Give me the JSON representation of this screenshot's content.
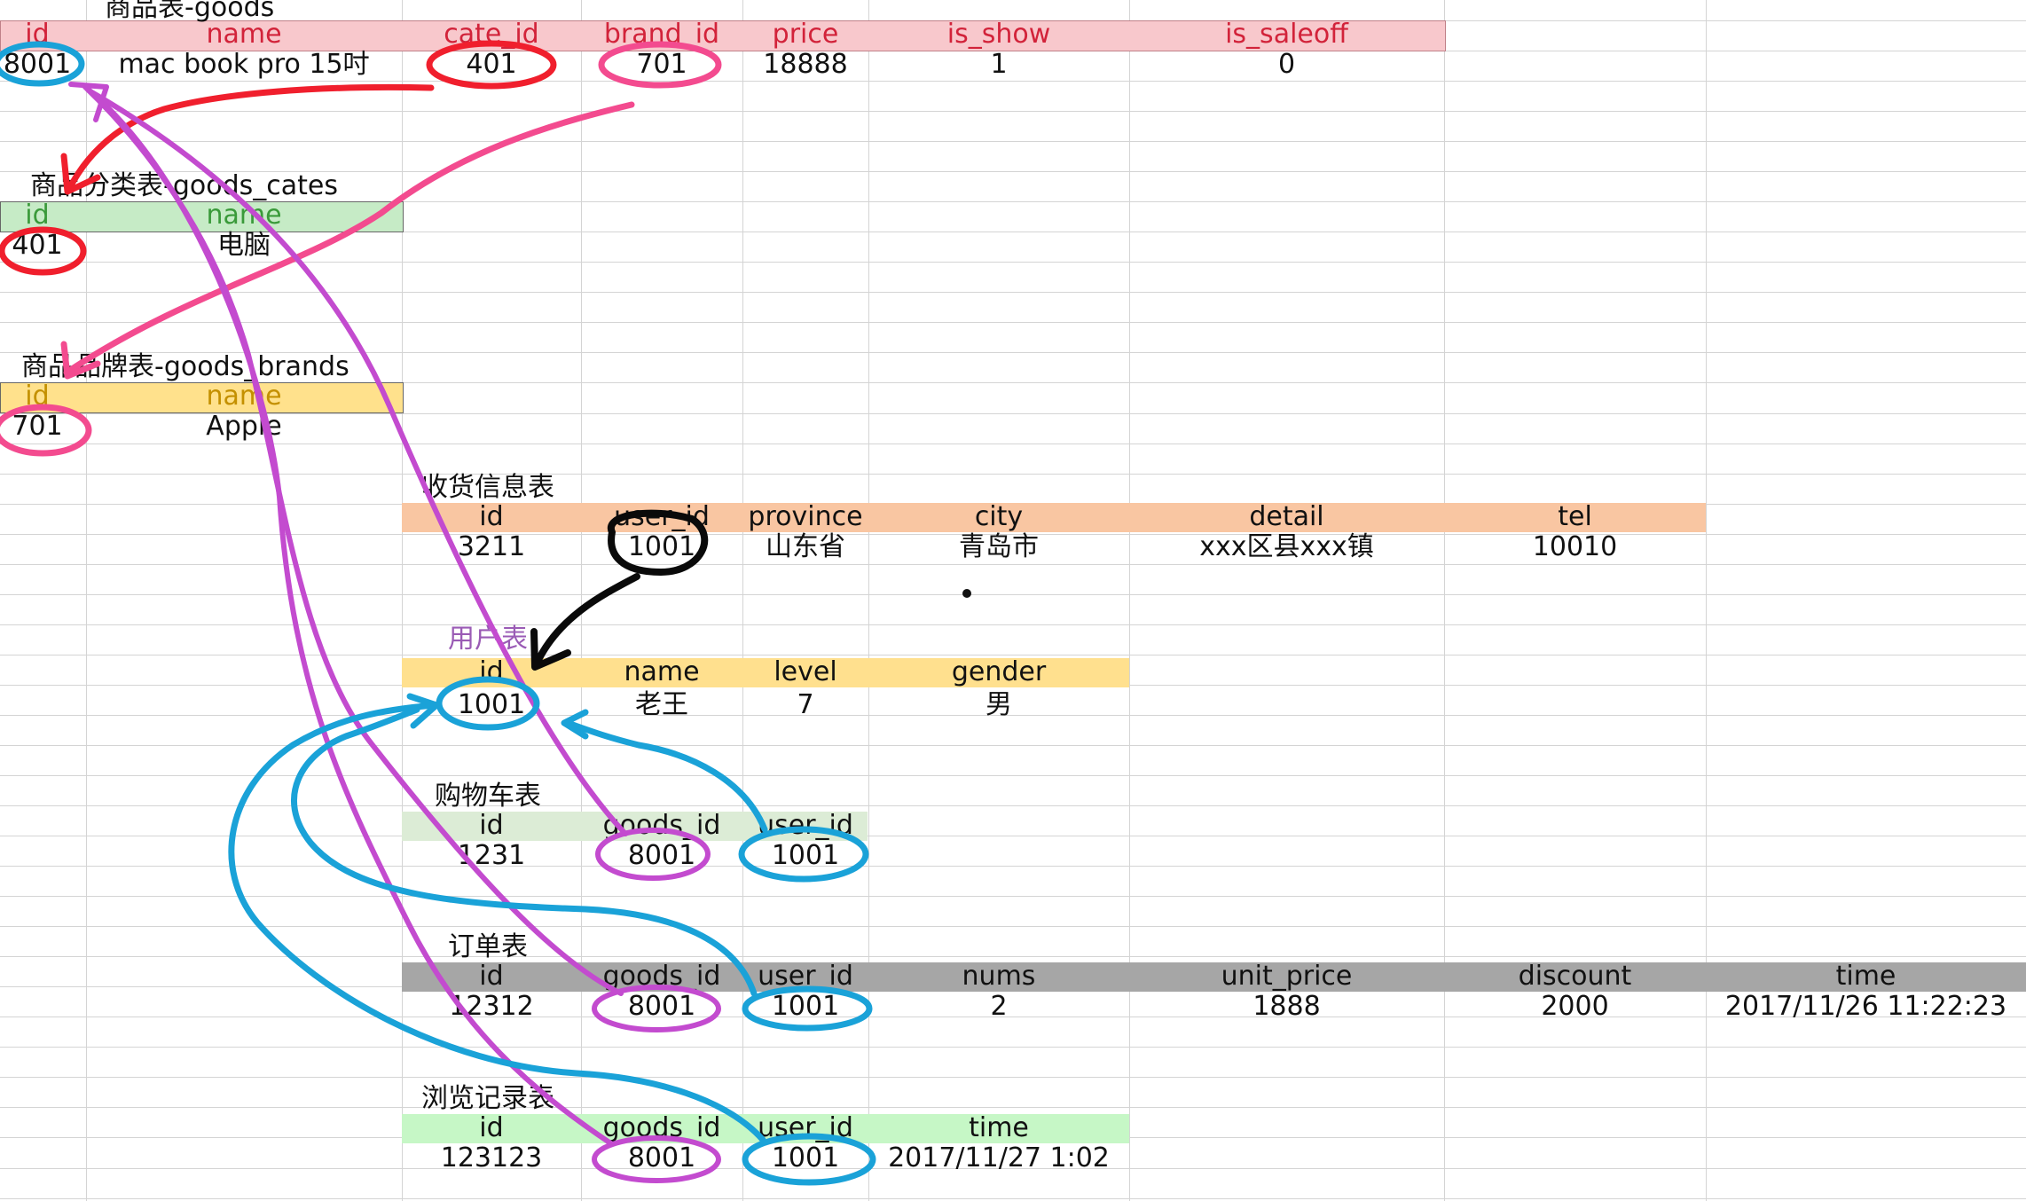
{
  "colors": {
    "goods_header": "#f8c8cc",
    "goods_header_text": "#d2233a",
    "cates_header": "#c6ebc6",
    "cates_header_text": "#3a9a3a",
    "brands_header": "#ffe18c",
    "brands_header_text": "#c49000",
    "address_header": "#f9c6a2",
    "users_header": "#ffe08e",
    "users_title_text": "#9a5bb5",
    "cart_header": "#dcecd6",
    "orders_header": "#a6a6a6",
    "browse_header": "#c6f7c6",
    "annotation_red": "#f01f2d",
    "annotation_pink": "#f34b8f",
    "annotation_magenta": "#c34bcf",
    "annotation_blue": "#1aa2d8",
    "annotation_black": "#0a0a0a"
  },
  "goods": {
    "title": "商品表-goods",
    "headers": [
      "id",
      "name",
      "cate_id",
      "brand_id",
      "price",
      "is_show",
      "is_saleoff"
    ],
    "row": [
      "8001",
      "mac book pro 15吋",
      "401",
      "701",
      "18888",
      "1",
      "0"
    ]
  },
  "goods_cates": {
    "title": "商品分类表-goods_cates",
    "headers": [
      "id",
      "name"
    ],
    "row": [
      "401",
      "电脑"
    ]
  },
  "goods_brands": {
    "title": "商品品牌表-goods_brands",
    "headers": [
      "id",
      "name"
    ],
    "row": [
      "701",
      "Apple"
    ]
  },
  "address": {
    "title": "收货信息表",
    "headers": [
      "id",
      "user_id",
      "province",
      "city",
      "detail",
      "tel"
    ],
    "row": [
      "3211",
      "1001",
      "山东省",
      "青岛市",
      "xxx区县xxx镇",
      "10010"
    ]
  },
  "users": {
    "title": "用户表",
    "headers": [
      "id",
      "name",
      "level",
      "gender"
    ],
    "row": [
      "1001",
      "老王",
      "7",
      "男"
    ]
  },
  "cart": {
    "title": "购物车表",
    "headers": [
      "id",
      "goods_id",
      "user_id"
    ],
    "row": [
      "1231",
      "8001",
      "1001"
    ]
  },
  "orders": {
    "title": "订单表",
    "headers": [
      "id",
      "goods_id",
      "user_id",
      "nums",
      "unit_price",
      "discount",
      "time"
    ],
    "row": [
      "12312",
      "8001",
      "1001",
      "2",
      "1888",
      "2000",
      "2017/11/26 11:22:23"
    ]
  },
  "browse": {
    "title": "浏览记录表",
    "headers": [
      "id",
      "goods_id",
      "user_id",
      "time"
    ],
    "row": [
      "123123",
      "8001",
      "1001",
      "2017/11/27 1:02"
    ]
  }
}
